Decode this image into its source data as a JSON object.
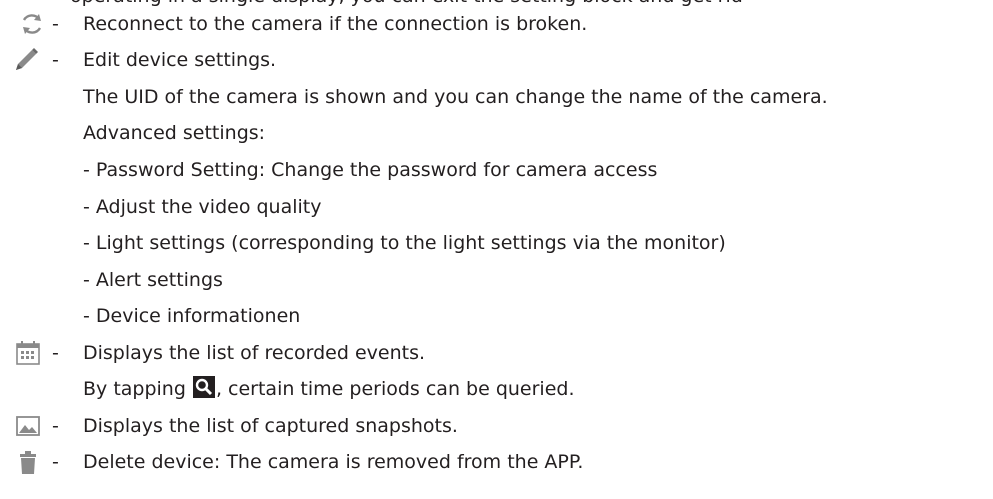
{
  "top_clipped": "operating in a single display, you can exit the setting block and get rid",
  "items": [
    {
      "icon": "refresh-icon",
      "dash": "-",
      "text": "Reconnect to the camera if the connection is broken."
    },
    {
      "icon": "pencil-icon",
      "dash": "-",
      "text": "Edit device settings."
    },
    {
      "icon": "calendar-icon",
      "dash": "-",
      "text": "Displays the list of recorded events."
    },
    {
      "icon": "image-icon",
      "dash": "-",
      "text": "Displays the list of captured snapshots."
    },
    {
      "icon": "trash-icon",
      "dash": "-",
      "text": "Delete device: The camera is removed from the APP."
    }
  ],
  "edit_details": {
    "uid_line": "The UID of the camera is shown and you can change the name of the camera.",
    "advanced_heading": "Advanced settings:",
    "advanced_items": [
      "- Password Setting: Change the password for camera access",
      "- Adjust the video quality",
      "- Light settings (corresponding to the light settings via the monitor)",
      "- Alert settings",
      "- Device informationen"
    ]
  },
  "events_details": {
    "query_before": "By tapping ",
    "query_after": ", certain time periods can be queried.",
    "query_icon": "search-icon"
  },
  "colors": {
    "text": "#231f20",
    "icon_gray": "#8a8a8a"
  }
}
